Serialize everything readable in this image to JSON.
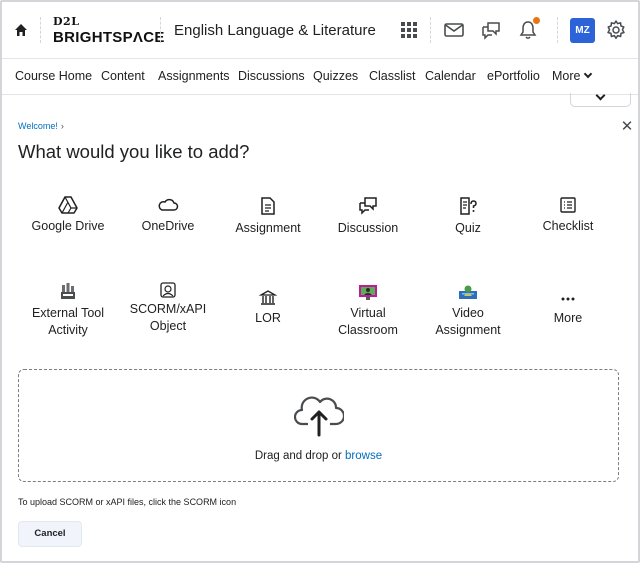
{
  "header": {
    "logo_top": "D2L",
    "logo_bottom": "BRIGHTSPΛCE",
    "course_title": "English Language & Literature",
    "avatar_initials": "MZ",
    "notification_badge_color": "#e87511",
    "avatar_color": "#2c63d8"
  },
  "nav": {
    "items": [
      "Course Home",
      "Content",
      "Assignments",
      "Discussions",
      "Quizzes",
      "Classlist",
      "Calendar",
      "ePortfolio",
      "More"
    ]
  },
  "dialog": {
    "breadcrumb": "Welcome!",
    "title": "What would you like to add?",
    "tiles_row1": [
      "Google Drive",
      "OneDrive",
      "Assignment",
      "Discussion",
      "Quiz",
      "Checklist"
    ],
    "tiles_row2": {
      "external_tool_1": "External Tool",
      "external_tool_2": "Activity",
      "scorm_1": "SCORM/xAPI",
      "scorm_2": "Object",
      "lor": "LOR",
      "virtual_1": "Virtual",
      "virtual_2": "Classroom",
      "video_1": "Video",
      "video_2": "Assignment",
      "more": "More"
    },
    "dropzone": {
      "text": "Drag and drop or",
      "link": "browse"
    },
    "hint": "To upload SCORM or xAPI files, click the SCORM icon",
    "cancel_label": "Cancel"
  },
  "colors": {
    "link": "#006fbf",
    "text": "#202122"
  }
}
